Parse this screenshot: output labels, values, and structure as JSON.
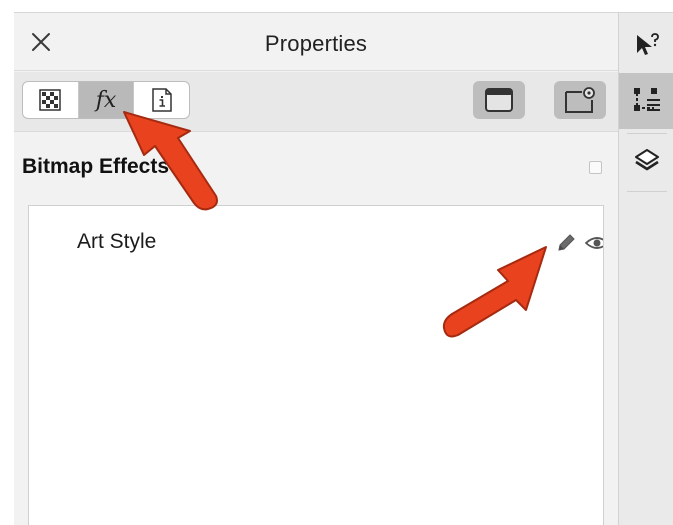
{
  "panel": {
    "title": "Properties",
    "close_icon": "close-icon"
  },
  "toolbar": {
    "tabs": [
      {
        "id": "transparency",
        "icon": "checkerboard-icon",
        "label": "",
        "active": false
      },
      {
        "id": "effects",
        "icon": "fx-icon",
        "label": "fx",
        "active": true
      },
      {
        "id": "info",
        "icon": "info-icon",
        "label": "",
        "active": false
      }
    ],
    "right_buttons": [
      {
        "id": "frame-view",
        "icon": "frame-icon"
      },
      {
        "id": "frame-settings",
        "icon": "frame-gear-icon"
      }
    ]
  },
  "section": {
    "title": "Bitmap Effects"
  },
  "effects": [
    {
      "name": "Art Style",
      "edit_icon": "pencil-icon",
      "visibility_icon": "eye-icon"
    }
  ],
  "dock": {
    "items": [
      {
        "id": "hints",
        "icon": "cursor-help-icon",
        "active": false
      },
      {
        "id": "properties",
        "icon": "properties-icon",
        "active": true
      },
      {
        "id": "objects",
        "icon": "layers-icon",
        "active": false
      }
    ]
  },
  "colors": {
    "panel_bg": "#f2f2f2",
    "toolbar_bg": "#e8e8e8",
    "active_tab": "#b9b9b9",
    "annotation_arrow": "#e8421f",
    "list_bg": "#ffffff"
  }
}
